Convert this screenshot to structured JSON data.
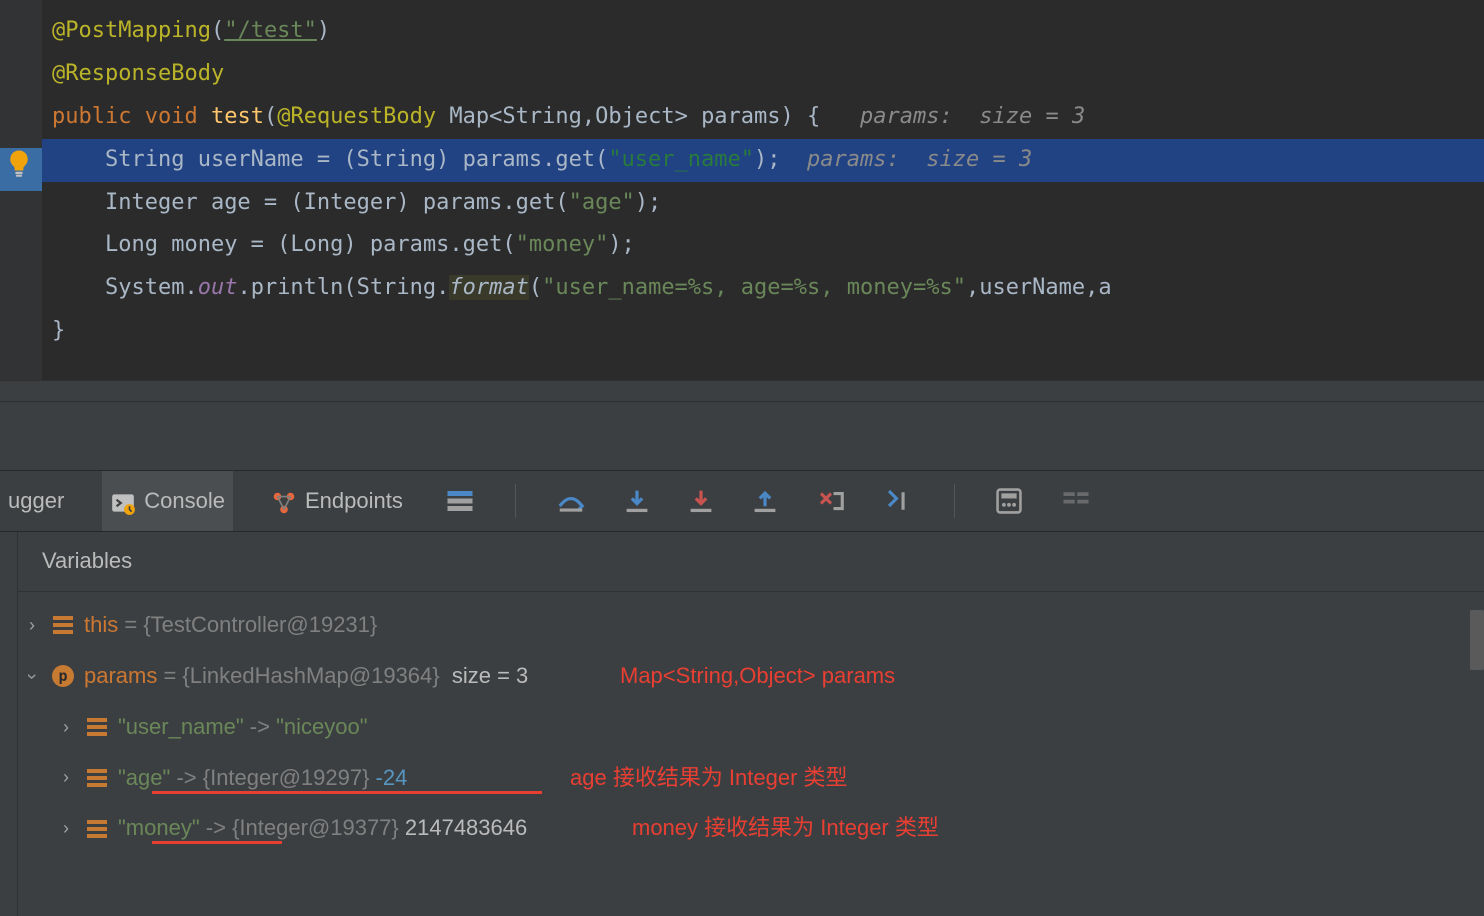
{
  "code": {
    "anno1": "@PostMapping",
    "anno1_arg_open": "(",
    "anno1_str": "\"/test\"",
    "anno1_close": ")",
    "anno2": "@ResponseBody",
    "sig_public": "public",
    "sig_void": "void",
    "sig_name": "test",
    "sig_rb": "@RequestBody",
    "sig_params": "Map<String,Object> params)",
    "sig_brace": " {",
    "sig_hint": "params:  size = 3",
    "l1_a": "String userName = (String) params.get(",
    "l1_s": "\"user_name\"",
    "l1_b": ");",
    "l1_hint": "params:  size = 3",
    "l2_a": "Integer age = (Integer) params.get(",
    "l2_s": "\"age\"",
    "l2_b": ");",
    "l3_a": "Long money = (Long) params.get(",
    "l3_s": "\"money\"",
    "l3_b": ");",
    "l4_a": "System.",
    "l4_out": "out",
    "l4_b": ".println(String.",
    "l4_fmt": "format",
    "l4_c": "(",
    "l4_s": "\"user_name=%s, age=%s, money=%s\"",
    "l4_d": ",userName,a",
    "close_brace": "}"
  },
  "toolbar": {
    "debugger": "ugger",
    "console": "Console",
    "endpoints": "Endpoints"
  },
  "vars": {
    "header": "Variables",
    "this_name": "this",
    "this_val": " = {TestController@19231}",
    "params_name": "params",
    "params_type": " = {LinkedHashMap@19364}  ",
    "params_size": "size = 3",
    "red_params": "Map<String,Object> params",
    "e0_key": "\"user_name\"",
    "arrow_str": " -> ",
    "e0_val": "\"niceyoo\"",
    "e1_key": "\"age\"",
    "e1_type": "{Integer@19297} ",
    "e1_val": "-24",
    "red_age": "age 接收结果为 Integer 类型",
    "e2_key": "\"money\"",
    "e2_type": "{Integer@19377} ",
    "e2_val": "2147483646",
    "red_money": "money 接收结果为 Integer 类型",
    "p_badge": "p"
  }
}
